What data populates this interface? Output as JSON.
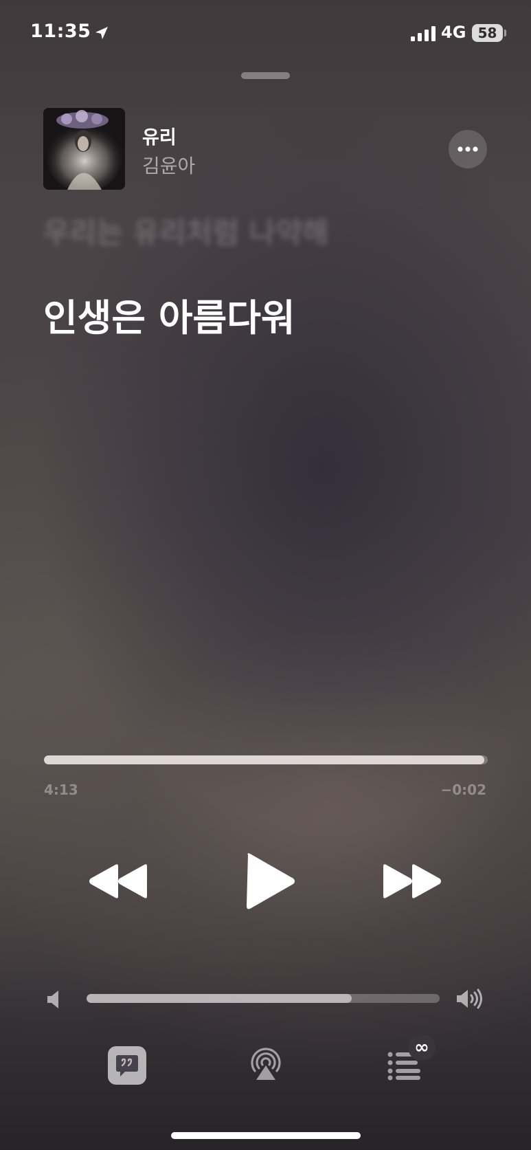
{
  "status_bar": {
    "time": "11:35",
    "network": "4G",
    "battery": "58",
    "icons": [
      "location-arrow-icon",
      "cellular-signal-icon",
      "battery-icon"
    ]
  },
  "now_playing": {
    "title": "유리",
    "artist": "김윤아",
    "more_icon": "ellipsis-icon"
  },
  "lyrics": {
    "previous_line": "우리는 유리처럼 나약해",
    "current_line": "인생은 아름다워"
  },
  "progress": {
    "elapsed": "4:13",
    "remaining": "−0:02",
    "fraction": 0.992
  },
  "transport": {
    "icons": [
      "rewind-icon",
      "play-icon",
      "fast-forward-icon"
    ]
  },
  "volume": {
    "level": 0.75,
    "icons": [
      "speaker-low-icon",
      "speaker-high-icon"
    ]
  },
  "toolbar": {
    "autoplay_badge": "∞",
    "icons": [
      "lyrics-icon",
      "airplay-icon",
      "queue-list-icon",
      "infinity-icon"
    ]
  },
  "colors": {
    "background": "#4a4445",
    "progress_fill": "#ebe4e2",
    "text_primary": "#ffffff"
  }
}
